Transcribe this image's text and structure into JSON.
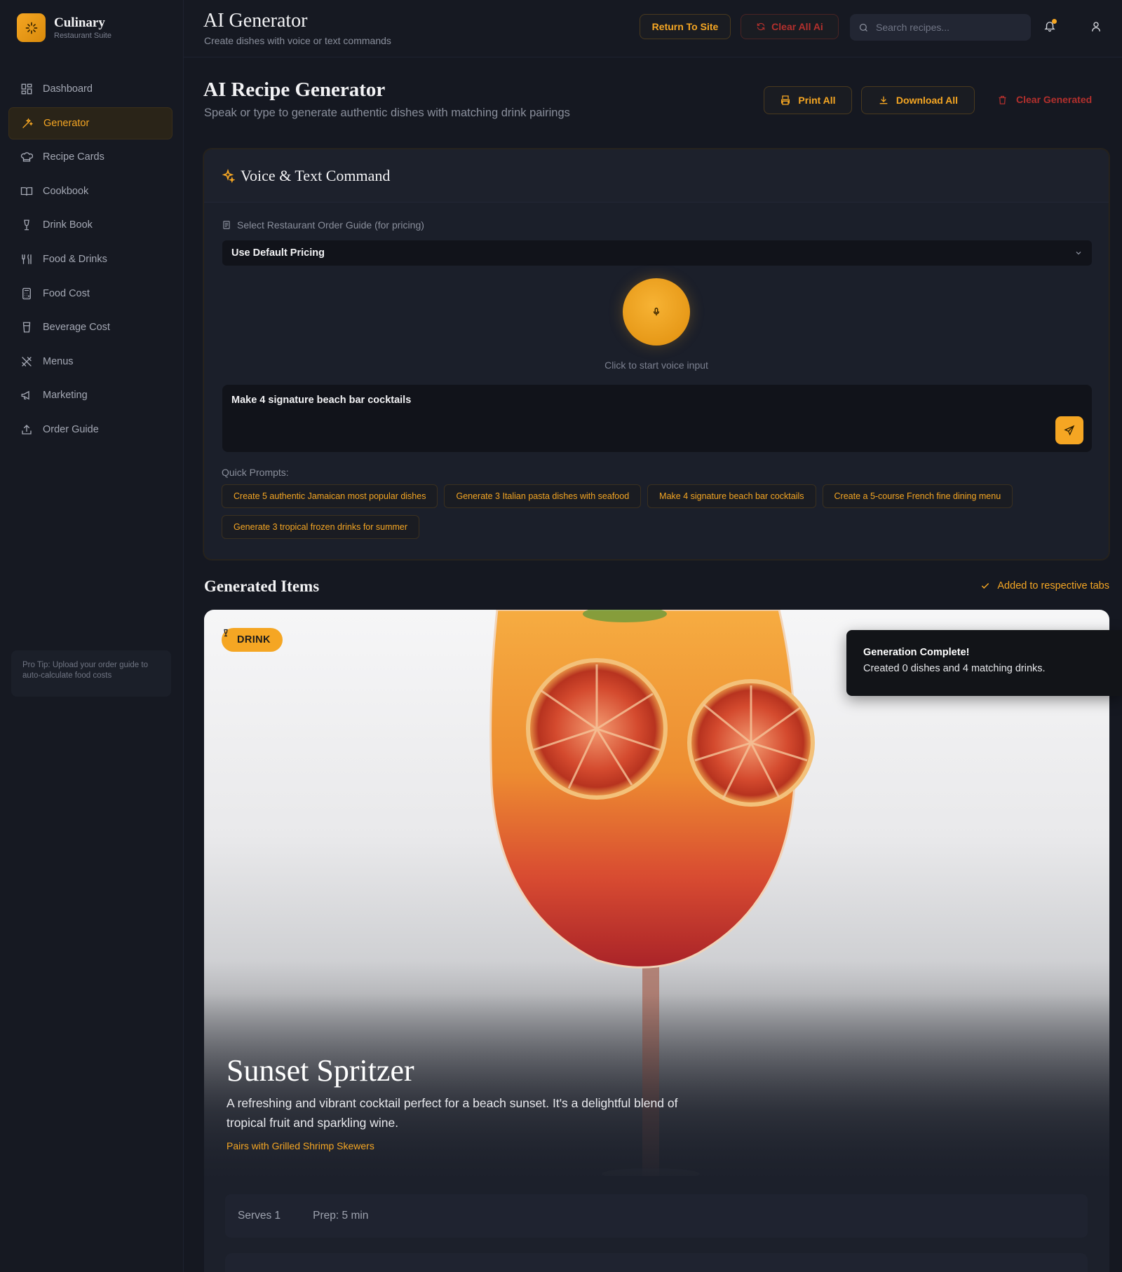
{
  "brand": {
    "name": "Culinary",
    "subtitle": "Restaurant Suite"
  },
  "sidebar": {
    "items": [
      {
        "label": "Dashboard",
        "icon": "dashboard-icon"
      },
      {
        "label": "Generator",
        "icon": "wand-icon",
        "active": true
      },
      {
        "label": "Recipe Cards",
        "icon": "chef-hat-icon"
      },
      {
        "label": "Cookbook",
        "icon": "book-open-icon"
      },
      {
        "label": "Drink Book",
        "icon": "wine-glass-icon"
      },
      {
        "label": "Food & Drinks",
        "icon": "utensils-icon"
      },
      {
        "label": "Food Cost",
        "icon": "calculator-icon"
      },
      {
        "label": "Beverage Cost",
        "icon": "cup-icon"
      },
      {
        "label": "Menus",
        "icon": "cutlery-cross-icon"
      },
      {
        "label": "Marketing",
        "icon": "megaphone-icon"
      },
      {
        "label": "Order Guide",
        "icon": "upload-icon"
      }
    ],
    "tip": "Pro Tip: Upload your order guide to auto-calculate food costs"
  },
  "header": {
    "title": "AI Generator",
    "subtitle": "Create dishes with voice or text commands",
    "return_label": "Return To Site",
    "clear_all_label": "Clear All Ai",
    "search_placeholder": "Search recipes..."
  },
  "page": {
    "title": "AI Recipe Generator",
    "subtitle": "Speak or type to generate authentic dishes with matching drink pairings",
    "print_label": "Print All",
    "download_label": "Download All",
    "clear_generated_label": "Clear Generated"
  },
  "command": {
    "title": "Voice & Text Command",
    "guide_label": "Select Restaurant Order Guide (for pricing)",
    "guide_value": "Use Default Pricing",
    "mic_caption": "Click to start voice input",
    "input_value": "Make 4 signature beach bar cocktails",
    "quick_label": "Quick Prompts:",
    "quick_prompts": [
      "Create 5 authentic Jamaican most popular dishes",
      "Generate 3 Italian pasta dishes with seafood",
      "Make 4 signature beach bar cocktails",
      "Create a 5-course French fine dining menu",
      "Generate 3 tropical frozen drinks for summer"
    ]
  },
  "generated": {
    "title": "Generated Items",
    "added_note": "Added to respective tabs",
    "item": {
      "badge": "DRINK",
      "name": "Sunset Spritzer",
      "description": "A refreshing and vibrant cocktail perfect for a beach sunset. It's a delightful blend of tropical fruit and sparkling wine.",
      "pairing": "Pairs with Grilled Shrimp Skewers",
      "serves": "Serves 1",
      "prep": "Prep: 5 min"
    }
  },
  "toast": {
    "title": "Generation Complete!",
    "message": "Created 0 dishes and 4 matching drinks."
  },
  "colors": {
    "accent": "#f5a623",
    "danger": "#b3302d",
    "background": "#151821"
  }
}
